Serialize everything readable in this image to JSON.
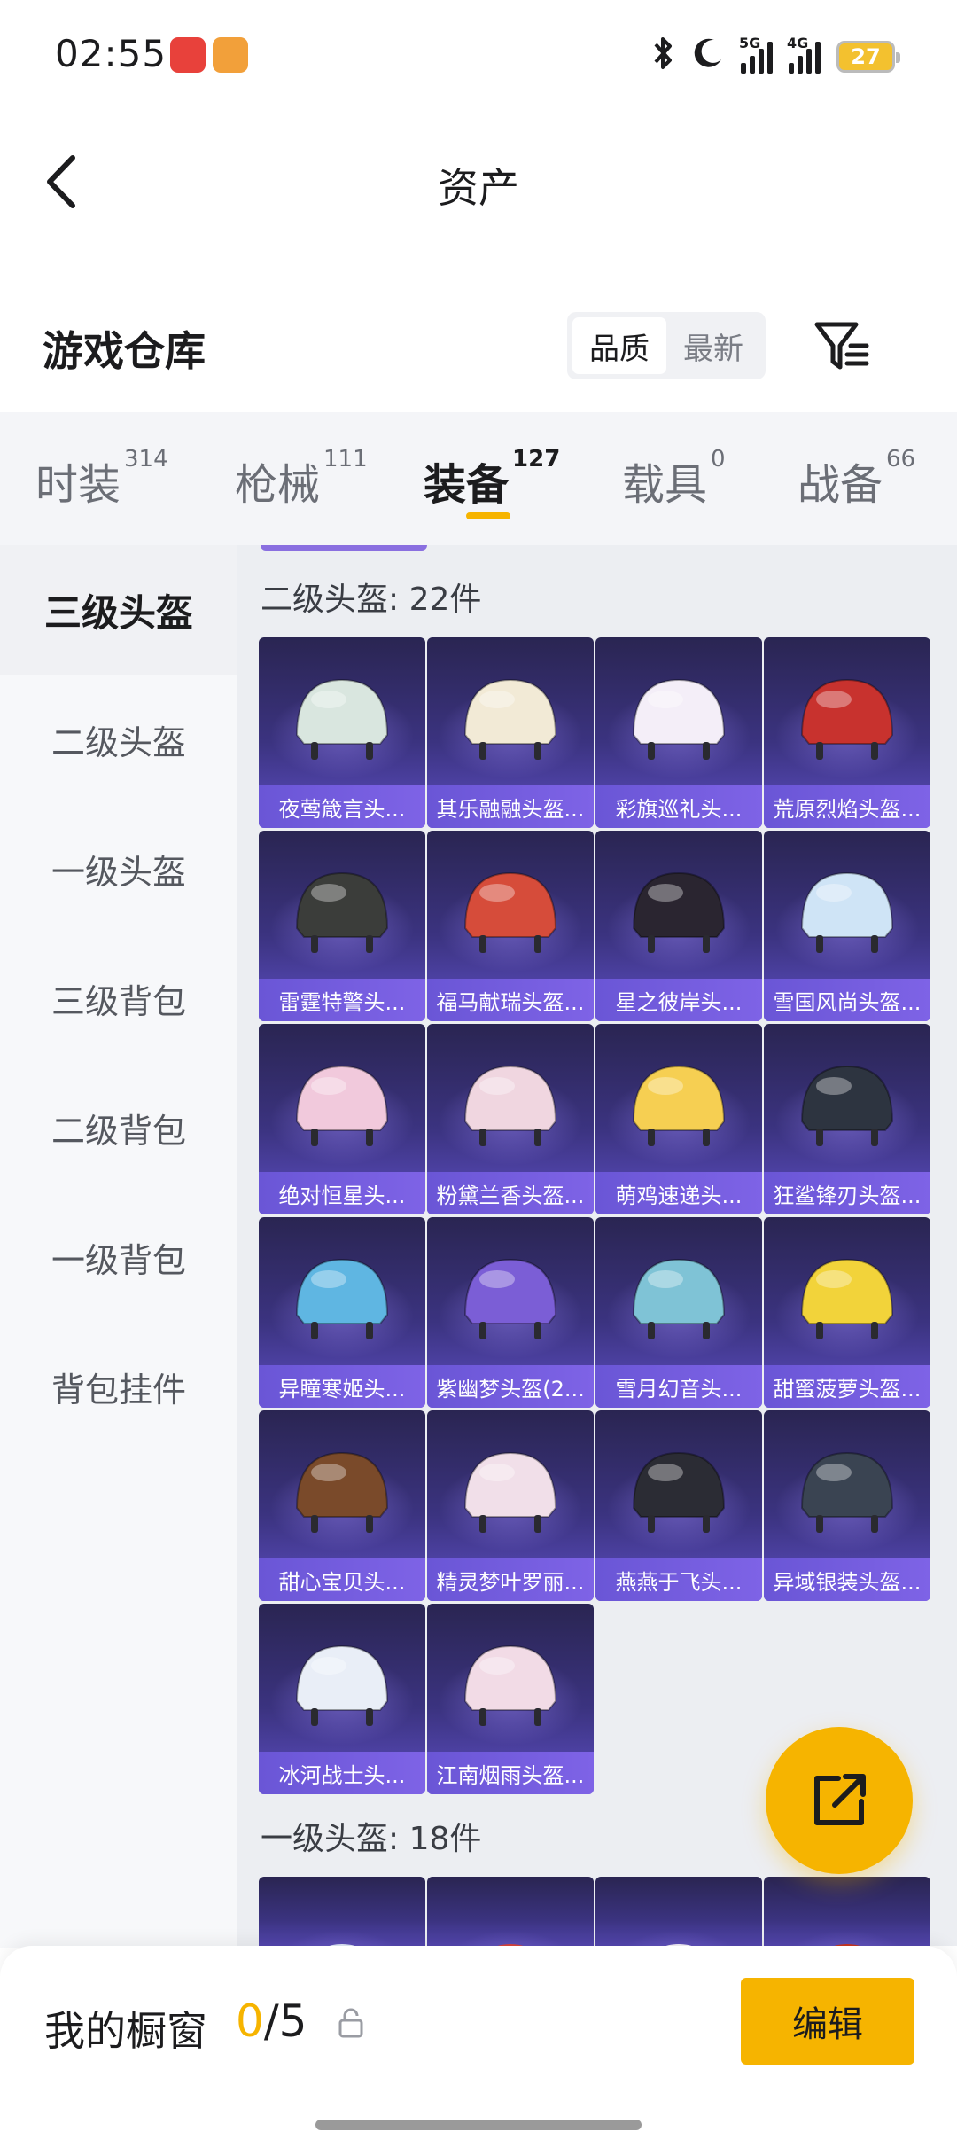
{
  "status_bar": {
    "time": "02:55",
    "bluetooth_icon": "bluetooth-icon",
    "moon_icon": "do-not-disturb-moon-icon",
    "signal1_label": "5G",
    "signal2_label": "4G",
    "battery": "27"
  },
  "header": {
    "title": "资产",
    "back_icon": "chevron-left-icon"
  },
  "section": {
    "title": "游戏仓库",
    "sort_options": [
      "品质",
      "最新"
    ],
    "sort_selected": "品质",
    "filter_icon": "filter-icon"
  },
  "tabs": [
    {
      "label": "时装",
      "count": "314"
    },
    {
      "label": "枪械",
      "count": "111"
    },
    {
      "label": "装备",
      "count": "127",
      "active": true
    },
    {
      "label": "载具",
      "count": "0"
    },
    {
      "label": "战备",
      "count": "66"
    }
  ],
  "sidebar": {
    "items": [
      "三级头盔",
      "二级头盔",
      "一级头盔",
      "三级背包",
      "二级背包",
      "一级背包",
      "背包挂件"
    ],
    "active": "三级头盔"
  },
  "groups": [
    {
      "title": "二级头盔: 22件",
      "items": [
        "夜莺箴言头...",
        "其乐融融头盔...",
        "彩旗巡礼头...",
        "荒原烈焰头盔...",
        "雷霆特警头...",
        "福马献瑞头盔...",
        "星之彼岸头...",
        "雪国风尚头盔...",
        "绝对恒星头...",
        "粉黛兰香头盔...",
        "萌鸡速递头...",
        "狂鲨锋刃头盔...",
        "异瞳寒姬头...",
        "紫幽梦头盔(2...",
        "雪月幻音头...",
        "甜蜜菠萝头盔...",
        "甜心宝贝头...",
        "精灵梦叶罗丽...",
        "燕燕于飞头...",
        "异域银装头盔...",
        "冰河战士头...",
        "江南烟雨头盔..."
      ]
    },
    {
      "title": "一级头盔: 18件"
    }
  ],
  "helmet_colors": [
    "#d9e6df",
    "#f2ead6",
    "#f4eef8",
    "#c8322e",
    "#3b3d3a",
    "#d64c3a",
    "#2a2530",
    "#cfe4f6",
    "#f1c9dc",
    "#f0d6e0",
    "#f6cf52",
    "#2d3440",
    "#5fb6e2",
    "#7b5ed6",
    "#7fc3d6",
    "#f2d33a",
    "#7a4a2a",
    "#f1dfe9",
    "#2b2c34",
    "#3a4452",
    "#e9eef7",
    "#f2dbe6"
  ],
  "fab": {
    "icon": "share-external-icon"
  },
  "bottom_bar": {
    "label": "我的橱窗",
    "count_current": "0",
    "count_total": "/5",
    "lock_icon": "lock-icon",
    "edit_label": "编辑"
  }
}
